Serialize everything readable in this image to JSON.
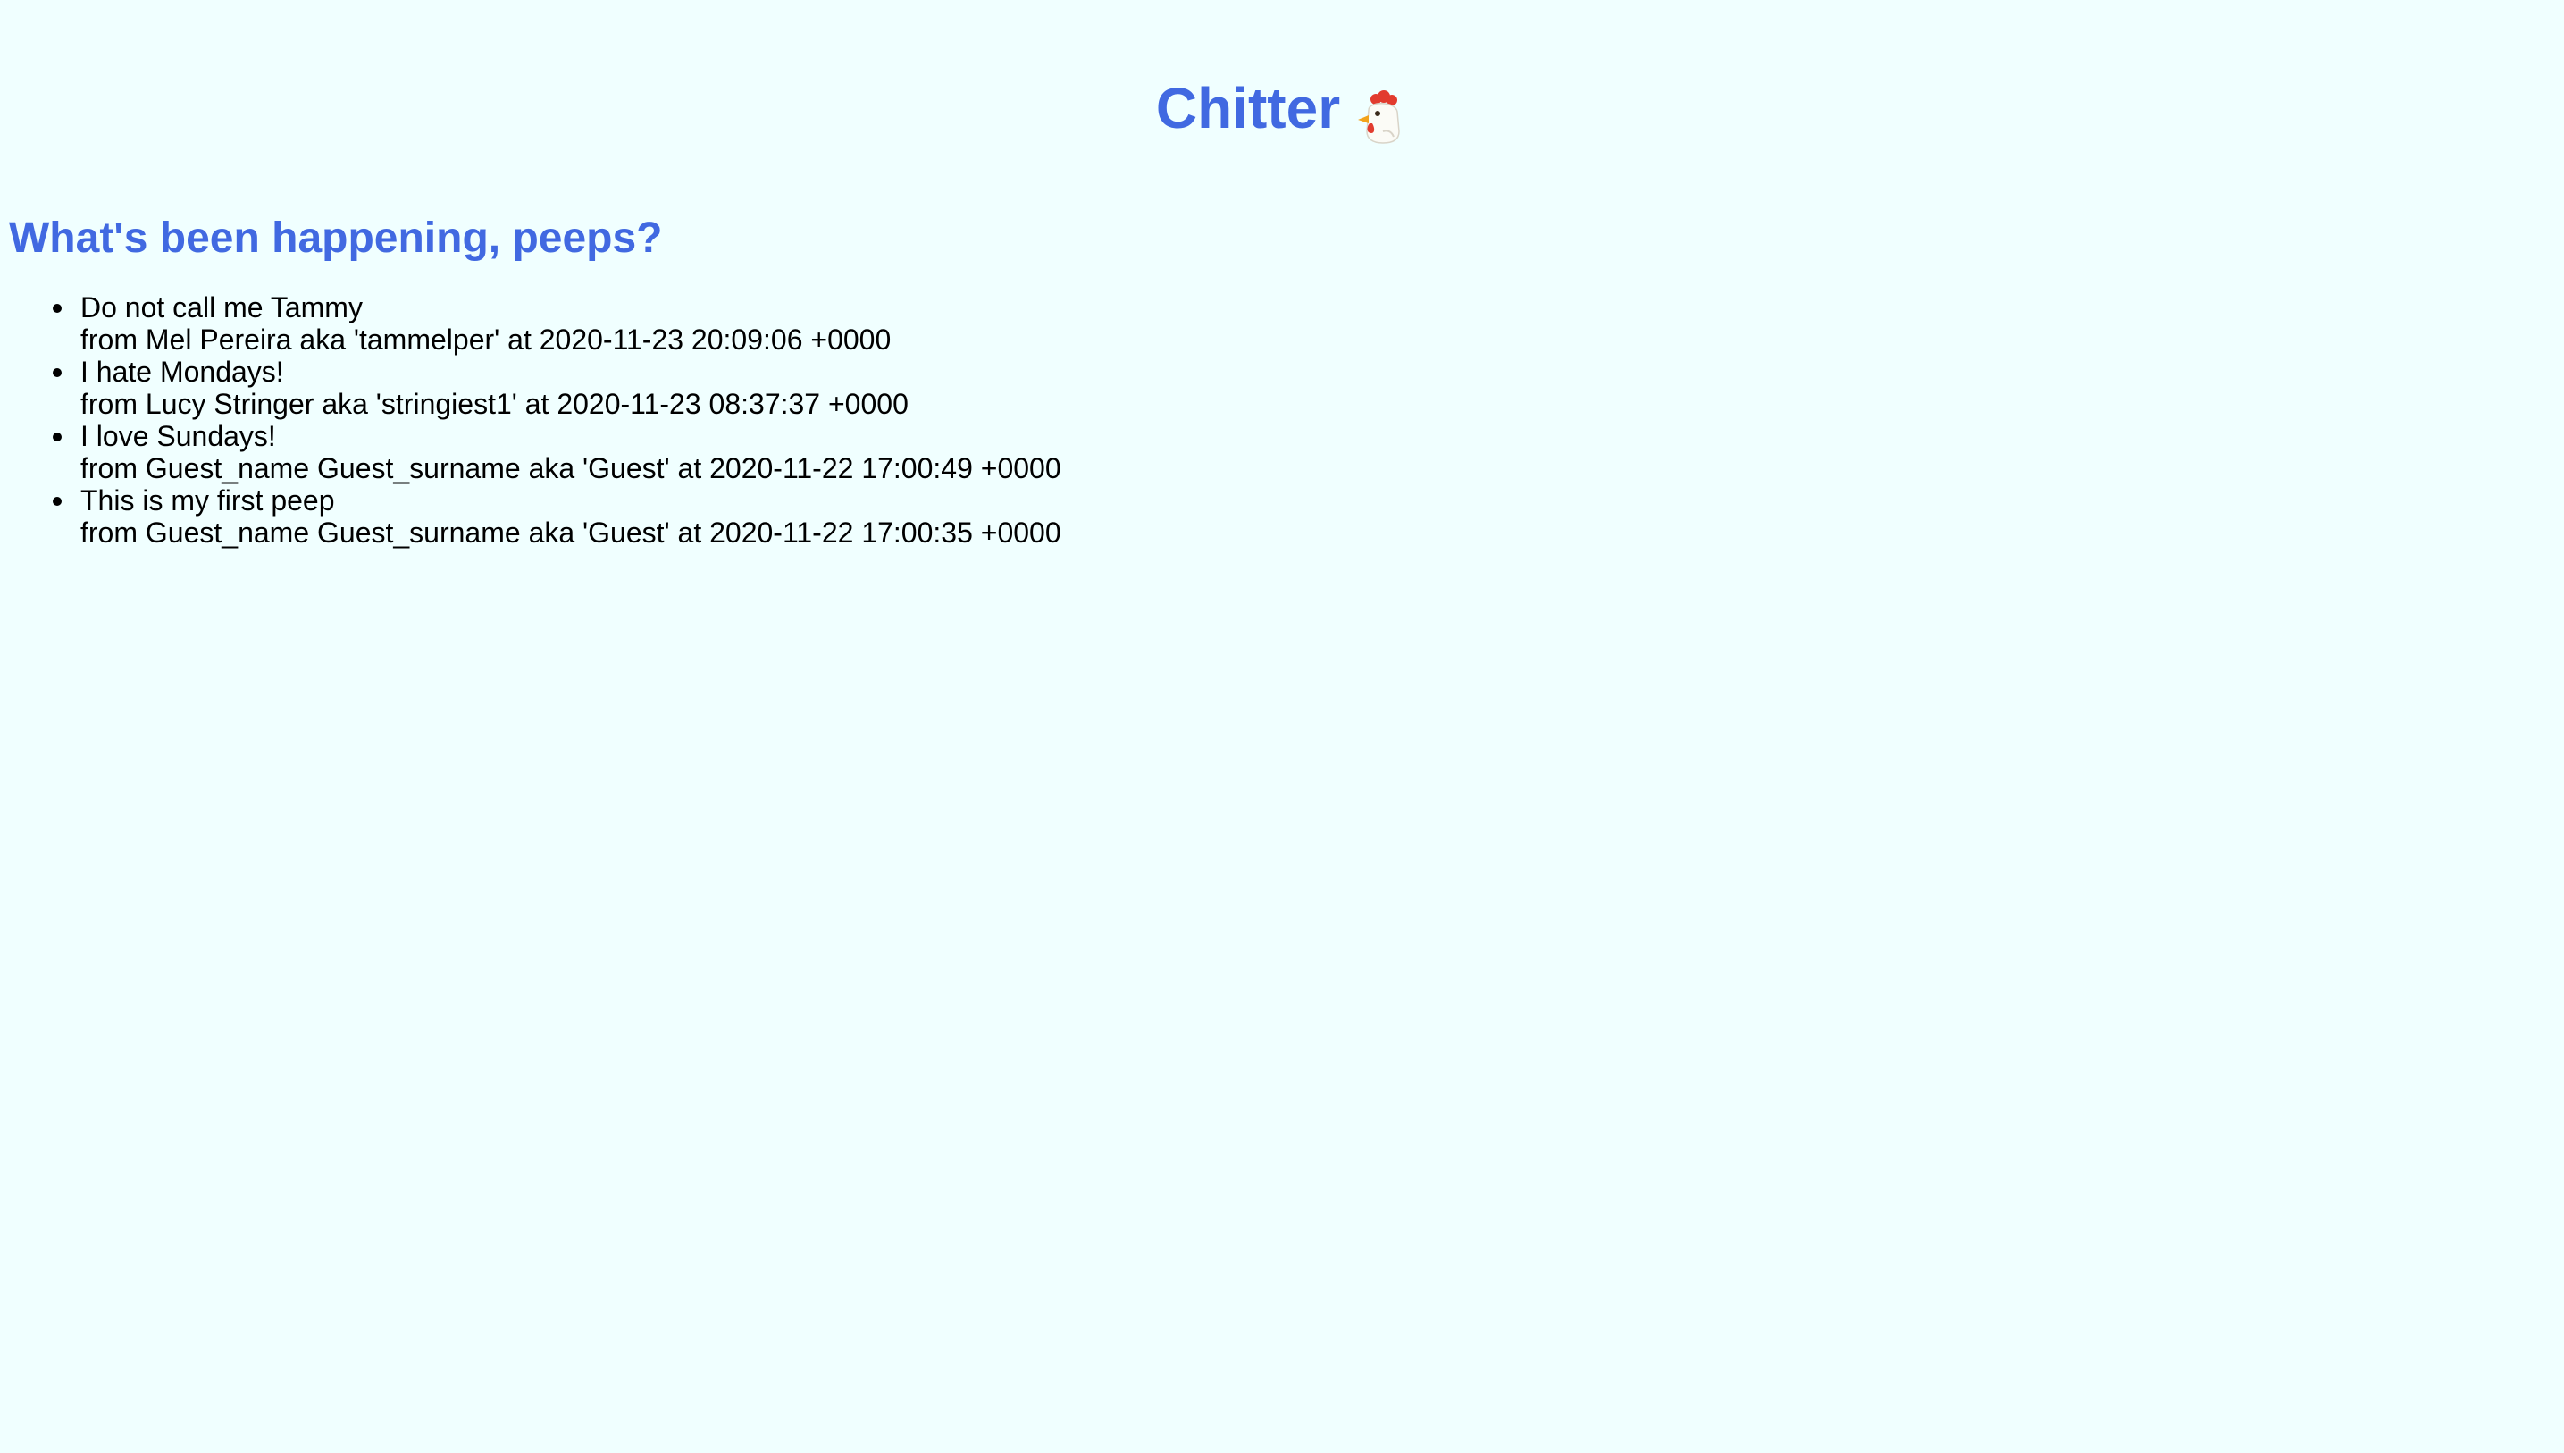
{
  "header": {
    "title": "Chitter",
    "logo_icon": "chicken-icon"
  },
  "feed": {
    "heading": "What's been happening, peeps?",
    "peeps": [
      {
        "text": "Do not call me Tammy",
        "meta": "from Mel Pereira aka 'tammelper' at 2020-11-23 20:09:06 +0000"
      },
      {
        "text": "I hate Mondays!",
        "meta": "from Lucy Stringer aka 'stringiest1' at 2020-11-23 08:37:37 +0000"
      },
      {
        "text": "I love Sundays!",
        "meta": "from Guest_name Guest_surname aka 'Guest' at 2020-11-22 17:00:49 +0000"
      },
      {
        "text": "This is my first peep",
        "meta": "from Guest_name Guest_surname aka 'Guest' at 2020-11-22 17:00:35 +0000"
      }
    ]
  },
  "colors": {
    "background": "#f0ffff",
    "heading": "#4169e1",
    "text": "#000000"
  }
}
